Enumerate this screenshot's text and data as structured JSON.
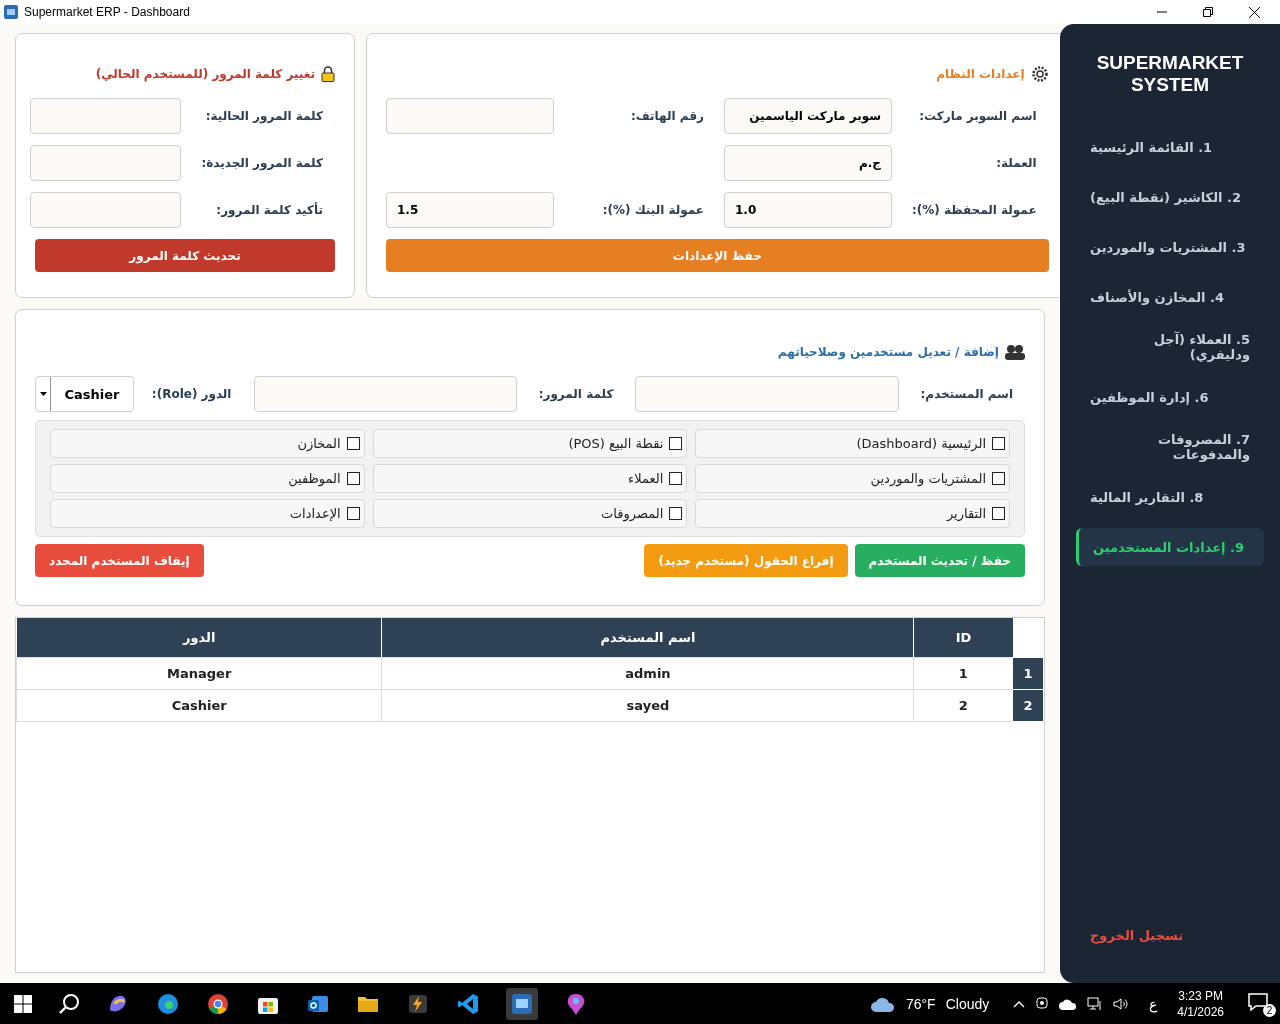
{
  "window": {
    "title": "Supermarket ERP - Dashboard"
  },
  "password_card": {
    "title": "تغيير كلمة المرور (للمستخدم الحالي)",
    "fields": [
      {
        "label": "كلمة المرور الحالية:"
      },
      {
        "label": "كلمة المرور الجديدة:"
      },
      {
        "label": "تأكيد كلمة المرور:"
      }
    ],
    "button": "تحديث كلمة المرور"
  },
  "settings_card": {
    "title": "إعدادات النظام",
    "fields": [
      {
        "label": "اسم السوبر ماركت:",
        "value": "سوبر ماركت الياسمين"
      },
      {
        "label": "رقم الهاتف:"
      },
      {
        "label": "العملة:",
        "value": "ج.م"
      },
      {
        "kind": "blank"
      },
      {
        "label": "عمولة المحفظة (%):",
        "value": "1.0"
      },
      {
        "label": "عمولة البنك (%):",
        "value": "1.5"
      }
    ],
    "button": "حفظ الإعدادات"
  },
  "users_card": {
    "title": "إضافة / تعديل مستخدمين وصلاحياتهم",
    "username_label": "اسم المستخدم:",
    "password_label": "كلمة المرور:",
    "role_label": "الدور (Role):",
    "role_value": "Cashier",
    "permissions": [
      {
        "label": "الرئيسية (Dashboard)",
        "checked": false
      },
      {
        "label": "نقطة البيع (POS)",
        "checked": false
      },
      {
        "label": "المخازن",
        "checked": false
      },
      {
        "label": "المشتريات والموردين",
        "checked": false
      },
      {
        "label": "العملاء",
        "checked": false
      },
      {
        "label": "الموظفين",
        "checked": false
      },
      {
        "label": "التقارير",
        "checked": false
      },
      {
        "label": "المصروفات",
        "checked": false
      },
      {
        "label": "الإعدادات",
        "checked": false
      }
    ],
    "buttons": [
      {
        "label": "حفظ / تحديث المستخدم",
        "kind": "save"
      },
      {
        "label": "إفراغ الحقول (مستخدم جديد)",
        "kind": "clear"
      },
      {
        "label": "إيقاف المستخدم المحدد",
        "kind": "stop"
      }
    ]
  },
  "table": {
    "columns": [
      "ID",
      "اسم المستخدم",
      "الدور"
    ],
    "rows": [
      {
        "header": "1",
        "cells": [
          "1",
          "admin",
          "Manager"
        ]
      },
      {
        "header": "2",
        "cells": [
          "2",
          "sayed",
          "Cashier"
        ]
      }
    ]
  },
  "sidebar": {
    "brand": "SUPERMARKET SYSTEM",
    "items": [
      {
        "label": "1. القائمة الرئيسية",
        "selected": false
      },
      {
        "label": "2. الكاشير (نقطة البيع)",
        "selected": false
      },
      {
        "label": "3. المشتريات والموردين",
        "selected": false
      },
      {
        "label": "4. المخازن والأصناف",
        "selected": false
      },
      {
        "label": "5. العملاء (آجل ودليفري)",
        "selected": false
      },
      {
        "label": "6. إدارة الموظفين",
        "selected": false
      },
      {
        "label": "7. المصروفات والمدفوعات",
        "selected": false
      },
      {
        "label": "8. التقارير المالية",
        "selected": false
      },
      {
        "label": "9. إعدادات المستخدمين",
        "selected": true
      }
    ],
    "logout": "تسجيل الخروج"
  },
  "taskbar": {
    "temperature": "76°F",
    "weather": "Cloudy",
    "language": "ع",
    "time": "3:23 PM",
    "date": "4/1/2026",
    "notifications": "2"
  }
}
